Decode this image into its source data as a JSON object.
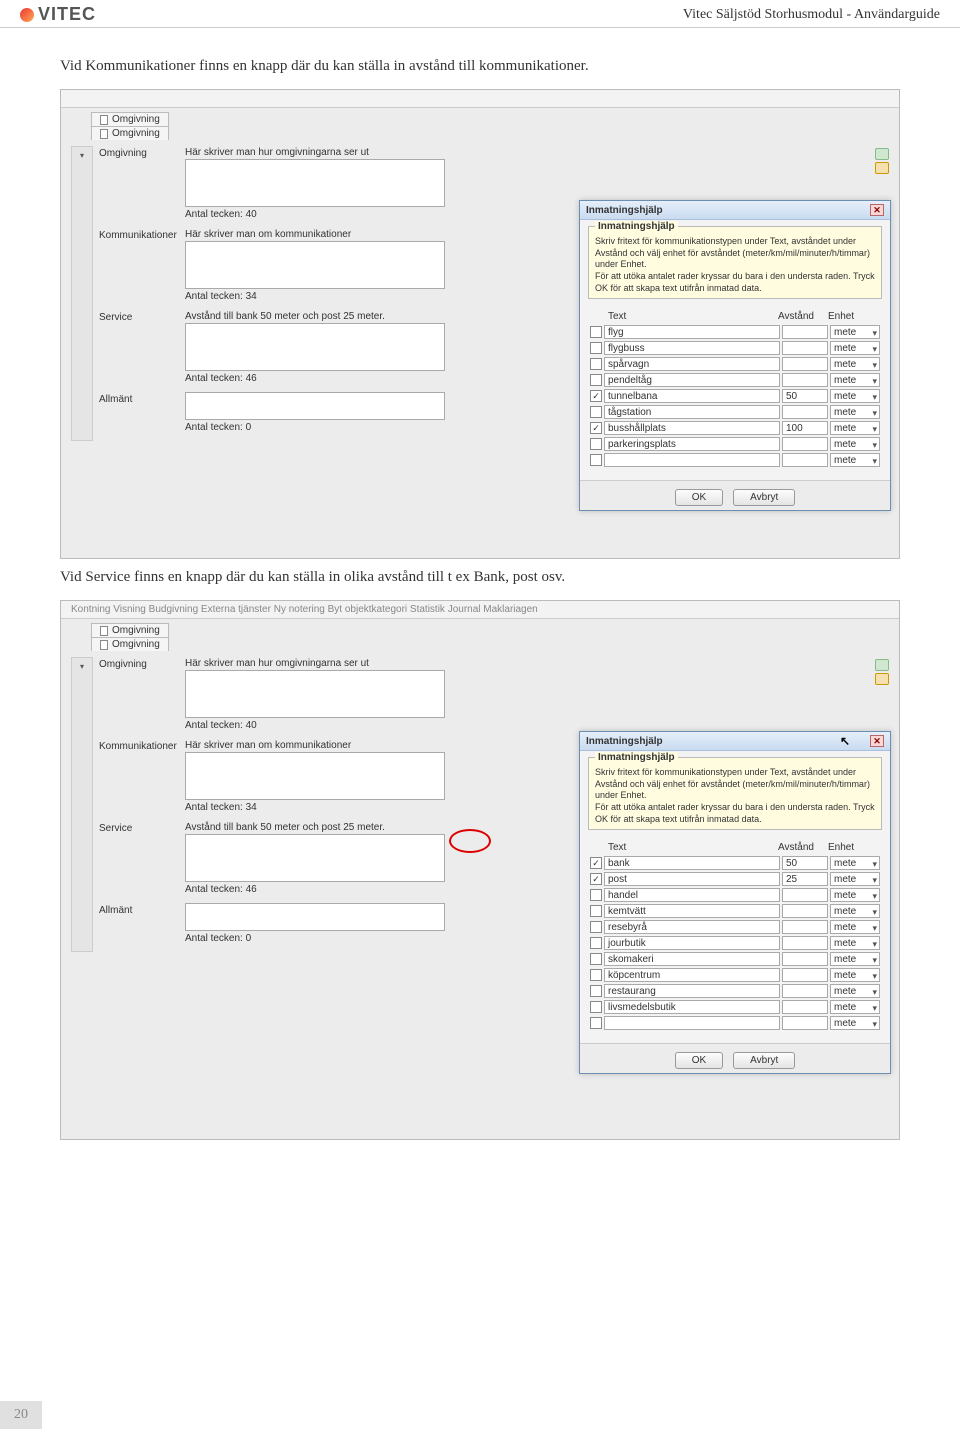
{
  "header": {
    "logo_text": "VITEC",
    "doc_title": "Vitec Säljstöd Storhusmodul - Användarguide"
  },
  "intro1": "Vid Kommunikationer finns en knapp där du kan ställa in avstånd till kommunikationer.",
  "intro2": "Vid Service finns en knapp där du kan ställa in olika avstånd till t ex Bank, post osv.",
  "page_number": "20",
  "screenshot1": {
    "tabs": [
      "Omgivning",
      "Omgivning"
    ],
    "rows": {
      "omgivning": {
        "label": "Omgivning",
        "desc": "Här skriver man hur omgivningarna ser ut",
        "count": "Antal tecken:  40"
      },
      "komm": {
        "label": "Kommunikationer",
        "desc": "Här skriver man om kommunikationer",
        "count": "Antal tecken:  34"
      },
      "service": {
        "label": "Service",
        "desc": "Avstånd till bank 50 meter och post 25 meter.",
        "count": "Antal tecken:  46"
      },
      "allmant": {
        "label": "Allmänt",
        "desc": "",
        "count": "Antal tecken:  0"
      }
    },
    "dialog": {
      "title": "Inmatningshjälp",
      "legend": "Inmatningshjälp",
      "help1": "Skriv fritext för kommunikationstypen under Text, avståndet under Avstånd och välj enhet för avståndet (meter/km/mil/minuter/h/timmar) under Enhet.",
      "help2": "För att utöka antalet rader kryssar du bara i den understa raden. Tryck OK för att skapa text utifrån inmatad data.",
      "headers": {
        "text": "Text",
        "dist": "Avstånd",
        "unit": "Enhet"
      },
      "rows": [
        {
          "checked": false,
          "text": "flyg",
          "dist": "",
          "unit": "mete"
        },
        {
          "checked": false,
          "text": "flygbuss",
          "dist": "",
          "unit": "mete"
        },
        {
          "checked": false,
          "text": "spårvagn",
          "dist": "",
          "unit": "mete"
        },
        {
          "checked": false,
          "text": "pendeltåg",
          "dist": "",
          "unit": "mete"
        },
        {
          "checked": true,
          "text": "tunnelbana",
          "dist": "50",
          "unit": "mete"
        },
        {
          "checked": false,
          "text": "tågstation",
          "dist": "",
          "unit": "mete"
        },
        {
          "checked": true,
          "text": "busshållplats",
          "dist": "100",
          "unit": "mete"
        },
        {
          "checked": false,
          "text": "parkeringsplats",
          "dist": "",
          "unit": "mete"
        },
        {
          "checked": false,
          "text": "",
          "dist": "",
          "unit": "mete"
        }
      ],
      "ok": "OK",
      "cancel": "Avbryt"
    }
  },
  "screenshot2": {
    "toolbar": "Kontning    Visning    Budgivning    Externa tjänster    Ny notering    Byt objektkategori    Statistik    Journal Maklariagen",
    "tabs": [
      "Omgivning",
      "Omgivning"
    ],
    "rows": {
      "omgivning": {
        "label": "Omgivning",
        "desc": "Här skriver man hur omgivningarna ser ut",
        "count": "Antal tecken:  40"
      },
      "komm": {
        "label": "Kommunikationer",
        "desc": "Här skriver man om kommunikationer",
        "count": "Antal tecken:  34"
      },
      "service": {
        "label": "Service",
        "desc": "Avstånd till bank 50 meter och post 25 meter.",
        "count": "Antal tecken:  46"
      },
      "allmant": {
        "label": "Allmänt",
        "desc": "",
        "count": "Antal tecken:  0"
      }
    },
    "dialog": {
      "title": "Inmatningshjälp",
      "legend": "Inmatningshjälp",
      "help1": "Skriv fritext för kommunikationstypen under Text, avståndet under Avstånd och välj enhet för avståndet (meter/km/mil/minuter/h/timmar) under Enhet.",
      "help2": "För att utöka antalet rader kryssar du bara i den understa raden. Tryck OK för att skapa text utifrån inmatad data.",
      "headers": {
        "text": "Text",
        "dist": "Avstånd",
        "unit": "Enhet"
      },
      "rows": [
        {
          "checked": true,
          "text": "bank",
          "dist": "50",
          "unit": "mete"
        },
        {
          "checked": true,
          "text": "post",
          "dist": "25",
          "unit": "mete"
        },
        {
          "checked": false,
          "text": "handel",
          "dist": "",
          "unit": "mete"
        },
        {
          "checked": false,
          "text": "kemtvätt",
          "dist": "",
          "unit": "mete"
        },
        {
          "checked": false,
          "text": "resebyrå",
          "dist": "",
          "unit": "mete"
        },
        {
          "checked": false,
          "text": "jourbutik",
          "dist": "",
          "unit": "mete"
        },
        {
          "checked": false,
          "text": "skomakeri",
          "dist": "",
          "unit": "mete"
        },
        {
          "checked": false,
          "text": "köpcentrum",
          "dist": "",
          "unit": "mete"
        },
        {
          "checked": false,
          "text": "restaurang",
          "dist": "",
          "unit": "mete"
        },
        {
          "checked": false,
          "text": "livsmedelsbutik",
          "dist": "",
          "unit": "mete"
        },
        {
          "checked": false,
          "text": "",
          "dist": "",
          "unit": "mete"
        }
      ],
      "ok": "OK",
      "cancel": "Avbryt"
    }
  }
}
